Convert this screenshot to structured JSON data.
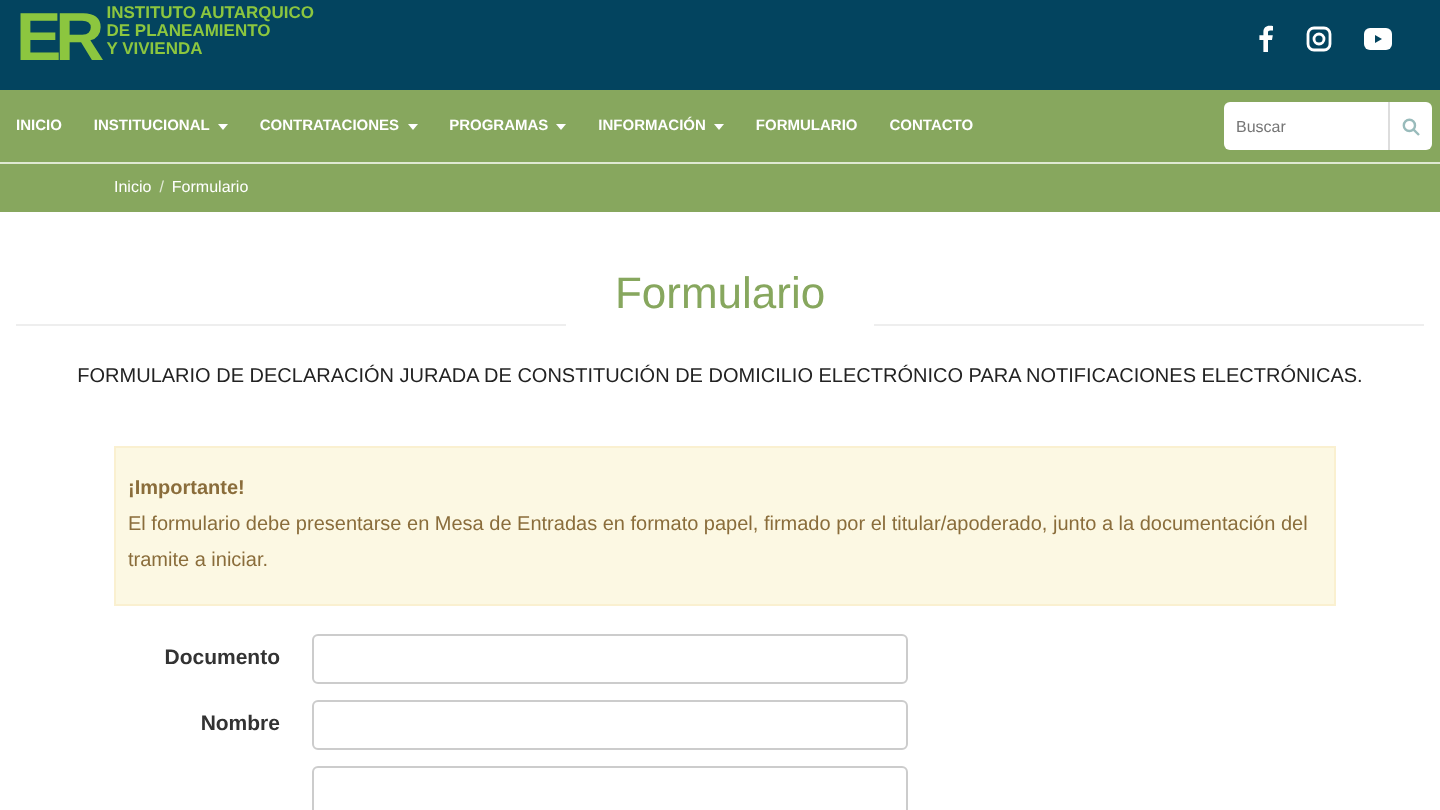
{
  "header": {
    "logo": "ER",
    "org_name": [
      "INSTITUTO AUTARQUICO",
      "DE PLANEAMIENTO",
      "Y VIVIENDA"
    ],
    "social": [
      {
        "kind": "facebook"
      },
      {
        "kind": "instagram"
      },
      {
        "kind": "youtube"
      }
    ]
  },
  "nav": {
    "items": [
      {
        "label": "INICIO",
        "dropdown": false
      },
      {
        "label": "INSTITUCIONAL",
        "dropdown": true
      },
      {
        "label": "CONTRATACIONES",
        "dropdown": true
      },
      {
        "label": "PROGRAMAS",
        "dropdown": true
      },
      {
        "label": "INFORMACIÓN",
        "dropdown": true
      },
      {
        "label": "FORMULARIO",
        "dropdown": false
      },
      {
        "label": "CONTACTO",
        "dropdown": false
      }
    ],
    "search": {
      "placeholder": "Buscar"
    }
  },
  "breadcrumb": {
    "items": [
      "Inicio",
      "Formulario"
    ],
    "separator": "/"
  },
  "page_title": "Formulario",
  "description": "FORMULARIO DE DECLARACIÓN JURADA DE CONSTITUCIÓN DE DOMICILIO ELECTRÓNICO PARA NOTIFICACIONES ELECTRÓNICAS.",
  "alert": {
    "title": "¡Importante!",
    "text": "El formulario debe presentarse en Mesa de Entradas en formato papel, firmado por el titular/apoderado, junto a la documentación del tramite a iniciar."
  },
  "fields": [
    {
      "kind": "text",
      "label": "Documento"
    },
    {
      "kind": "text",
      "label": "Nombre"
    },
    {
      "kind": "text"
    }
  ]
}
